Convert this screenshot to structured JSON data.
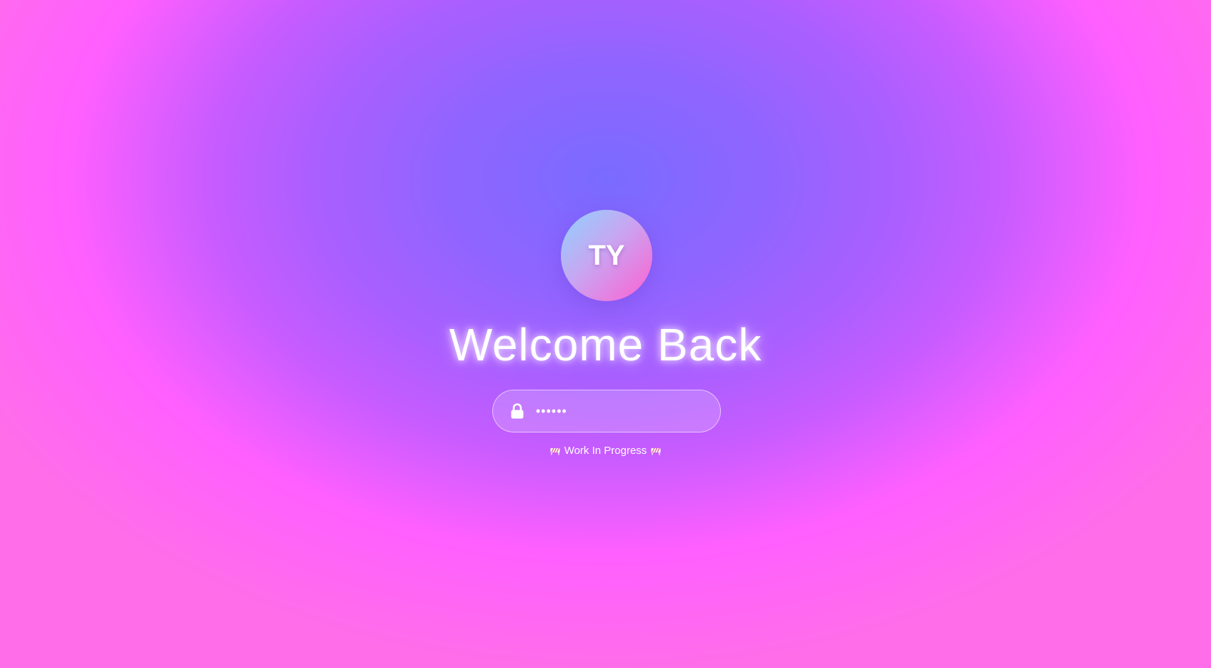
{
  "avatar": {
    "initials": "TY"
  },
  "login": {
    "title": "Welcome Back",
    "password_value": "••••••",
    "lock_icon": "lock-icon"
  },
  "status": {
    "text": "Work In Progress",
    "icon": "construction-barrier-icon"
  },
  "colors": {
    "background_center": "#7a6bff",
    "background_edge": "#ff5fff",
    "avatar_gradient_start": "#8fd2ff",
    "avatar_gradient_end": "#ff5fd0",
    "text": "#ffffff"
  }
}
